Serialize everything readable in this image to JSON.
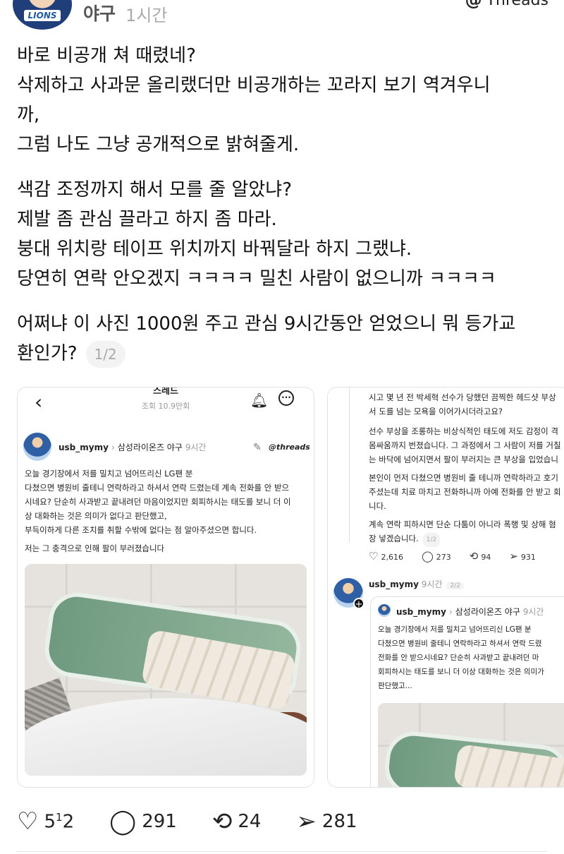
{
  "header": {
    "username": "야구",
    "time": "1시간",
    "brand": "Threads"
  },
  "post": {
    "paragraphs": [
      "바로 비공개 쳐 때렸네?\n삭제하고 사과문 올리랬더만 비공개하는 꼬라지 보기 역겨우니\n까,\n그럼 나도 그냥 공개적으로 밝혀줄게.",
      "색감 조정까지 해서 모를 줄 알았냐?\n제발 좀 관심 끌라고 하지 좀 마라.\n붕대 위치랑 테이프 위치까지 바꿔달라 하지 그랬냐.\n당연히 연락 안오겠지 ㅋㅋㅋㅋ 밀친 사람이 없으니까 ㅋㅋㅋㅋ",
      "어쩌냐 이 사진 1000원 주고 관심 9시간동안 얻었으니 뭐 등가교\n환인가?"
    ],
    "pager": "1/2"
  },
  "card1": {
    "title": "스레드",
    "views": "조회 10.9만회",
    "user": "usb_mymy",
    "group": "삼성라이온즈 야구",
    "time": "9시간",
    "threads_label": "threads",
    "body": "오늘 경기장에서 저를 밀치고 넘어뜨리신 LG팬 분\n다쳤으면 병원비 줄테니 연락하라고 하셔서 연락 드렸는데 계속 전화를 안 받으\n시네요? 단순히 사과받고 끝내려던 마음이었지만 회피하시는 태도를 보니 더 이\n상 대화하는 것은 의미가 없다고 판단했고,\n부득이하게 다른 조치를 취할 수밖에 없다는 점 알아주셨으면 합니다.",
    "body2": "저는 그 충격으로 인해 팔이 부러졌습니다"
  },
  "card2": {
    "body_top": "시고 몇 년 전 박세혁 선수가 당했던 끔찍한 헤드샷 부상\n서 도를 넘는 모욕을 이어가시더라고요?",
    "body_mid": "선수 부상을 조롱하는 비상식적인 태도에 저도 감정이 격\n몸싸움까지 번졌습니다. 그 과정에서 그 사람이 저를 거칠\n는 바닥에 넘어지면서 팔이 부러지는 큰 부상을 입었습니",
    "body_mid2": "본인이 먼저 다쳤으면 병원비 줄 테니까 연락하라고 호기\n주셨는데 치료 마치고 전화하니까 아예 전화를 안 받고 회\n니다.",
    "body_end": "계속 연락 피하시면 단순 다툼이 아니라 폭행 및 상해 혐\n장 넣겠습니다.",
    "pager_1": "1/2",
    "stats": {
      "likes": "2,616",
      "replies": "273",
      "reposts": "94",
      "shares": "931"
    },
    "reply_user": "usb_mymy",
    "reply_time": "9시간",
    "pager_2": "2/2",
    "quote_user": "usb_mymy",
    "quote_group": "삼성라이온즈 야구",
    "quote_time": "9시간",
    "quote_body": "오늘 경기장에서 저를 밀치고 넘어뜨리신 LG팬 분\n다쳤으면 병원비 줄테니 연락하라고 하셔서 연락 드렸\n전화를 안 받으시네요? 단순히 사과받고 끝내려던 마\n회피하시는 태도를 보니 더 이상 대화하는 것은 의미가\n판단했고..."
  },
  "actions": {
    "likes_base": "5",
    "likes_sup": "1",
    "likes_tail": "2",
    "replies": "291",
    "reposts": "24",
    "shares": "281"
  },
  "icons": {
    "heart": "heart-icon",
    "comment": "comment-icon",
    "repost": "repost-icon",
    "share": "share-icon"
  }
}
